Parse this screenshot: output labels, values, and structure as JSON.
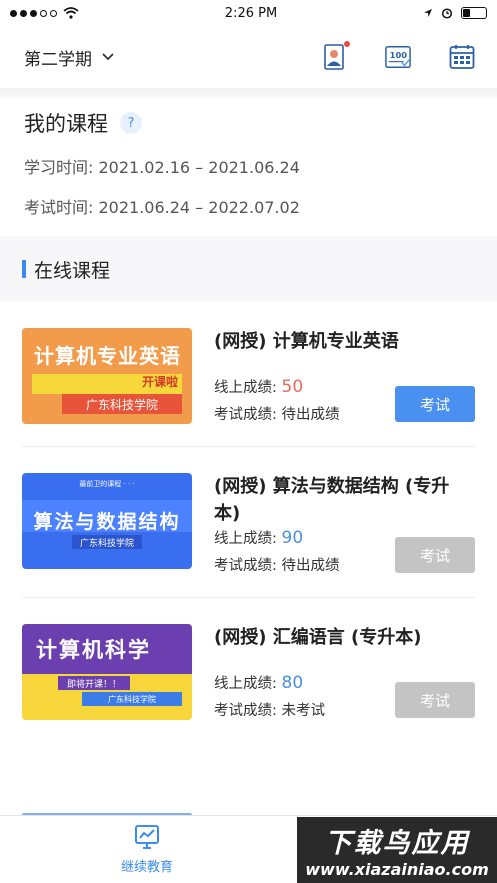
{
  "status_bar": {
    "time": "2:26 PM"
  },
  "nav": {
    "semester": "第二学期"
  },
  "my_courses": {
    "title": "我的课程",
    "help": "?",
    "study_time": "学习时间: 2021.02.16 – 2021.06.24",
    "exam_time": "考试时间: 2021.06.24 – 2022.07.02"
  },
  "section": {
    "title": "在线课程"
  },
  "courses": [
    {
      "name": "(网授) 计算机专业英语",
      "online_label": "线上成绩: ",
      "online_score": "50",
      "exam_label": "考试成绩: ",
      "exam_score": "待出成绩",
      "button": "考试",
      "thumb": {
        "title": "计算机专业英语",
        "sub": "开课啦",
        "school": "广东科技学院"
      }
    },
    {
      "name": "(网授) 算法与数据结构 (专升本)",
      "online_label": "线上成绩: ",
      "online_score": "90",
      "exam_label": "考试成绩: ",
      "exam_score": "待出成绩",
      "button": "考试",
      "thumb": {
        "small": "最前卫的课程 · · ·",
        "title": "算法与数据结构",
        "school": "广东科技学院"
      }
    },
    {
      "name": "(网授) 汇编语言 (专升本)",
      "online_label": "线上成绩: ",
      "online_score": "80",
      "exam_label": "考试成绩: ",
      "exam_score": "未考试",
      "button": "考试",
      "thumb": {
        "title": "计算机科学",
        "tag": "即将开课！！",
        "school": "广东科技学院"
      }
    }
  ],
  "tab_bar": {
    "label": "继续教育"
  },
  "watermark": {
    "title": "下载鸟应用",
    "url": "www.xiazainiao.com"
  },
  "colors": {
    "accent": "#3b8cf0",
    "red_score": "#e86a5a",
    "blue_score": "#4a90e2",
    "disabled": "#c4c4c4"
  }
}
